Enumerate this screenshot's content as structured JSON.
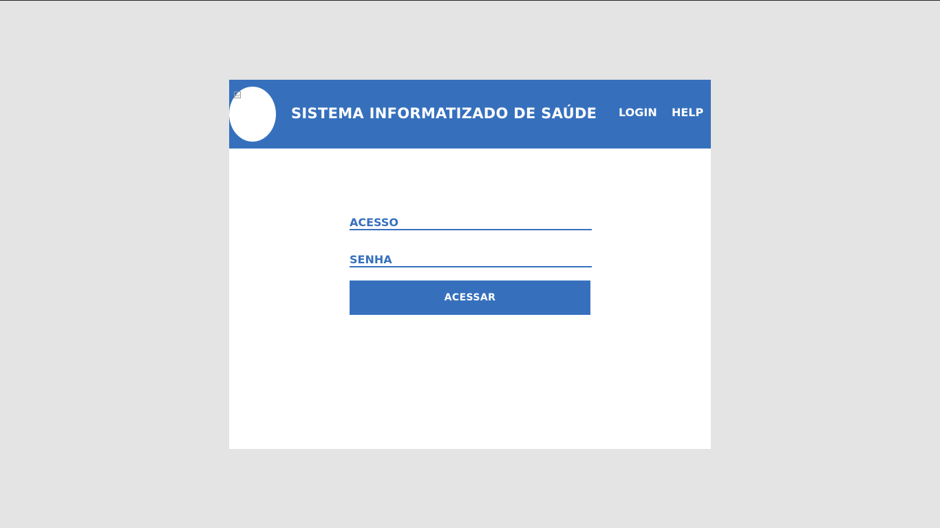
{
  "header": {
    "title": "SISTEMA INFORMATIZADO DE SAÚDE",
    "nav": {
      "login": "LOGIN",
      "help": "HELP"
    },
    "logo_icon": "broken-image-icon"
  },
  "form": {
    "username": {
      "value": "",
      "placeholder": "ACESSO"
    },
    "password": {
      "value": "",
      "placeholder": "SENHA"
    },
    "submit_label": "ACESSAR"
  },
  "colors": {
    "brand": "#3670bd",
    "background": "#e4e4e4",
    "card": "#ffffff"
  }
}
